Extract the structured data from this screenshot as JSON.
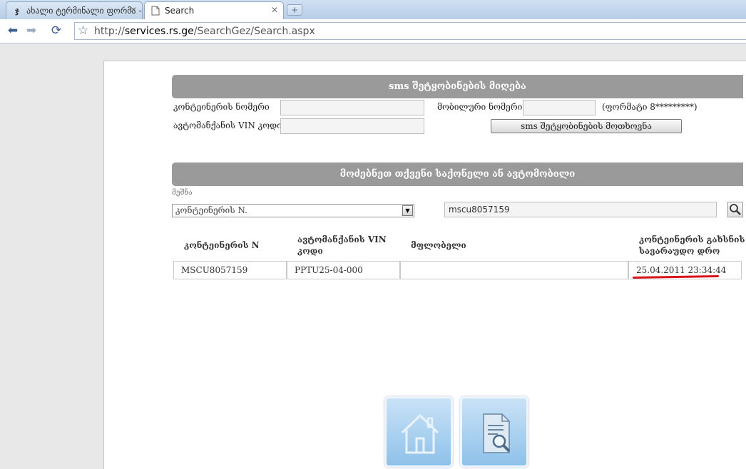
{
  "browser": {
    "tabs": [
      {
        "title": "ახალი ტერმინალი ფორმა -...",
        "favicon": "rs-logo",
        "active": false
      },
      {
        "title": "Search",
        "favicon": "page-icon",
        "active": true
      }
    ],
    "url_prefix": "http://",
    "url_host": "services.rs.ge",
    "url_path": "/SearchGez/Search.aspx"
  },
  "sms_section": {
    "header": "sms შეტყობინების მიღება",
    "container_label": "კონტეინერის ნომერი",
    "container_value": "",
    "vin_label": "ავტომანქანის VIN კოდი",
    "vin_value": "",
    "mobile_label": "მობილური ნომერი",
    "mobile_value": "",
    "format_hint": "(ფორმატი 8*********)",
    "request_button": "sms შეტყობინების მოთხოვნა"
  },
  "search_section": {
    "header": "მოძებნეთ თქვენი საქონელი ან ავტომობილი",
    "field_label": "მეშნა",
    "field_select": "კონტეინერის N.",
    "query": "mscu8057159"
  },
  "results": {
    "columns": [
      "კონტეინერის N",
      "ავტომანქანის VIN კოდი",
      "მფლობელი",
      "კონტეინერის გახსნის სავარაუდო დრო"
    ],
    "rows": [
      {
        "container": "MSCU8057159",
        "vin": "PPTU25-04-000",
        "owner": "",
        "open_time": "25.04.2011 23:34:44"
      }
    ]
  },
  "colors": {
    "header_bg": "#9a9a9a",
    "highlight": "#d7141a",
    "tile": "#8fc1ea"
  },
  "icons": [
    "back-icon",
    "forward-icon",
    "reload-icon",
    "star-icon",
    "search-icon",
    "home-icon",
    "document-search-icon"
  ]
}
